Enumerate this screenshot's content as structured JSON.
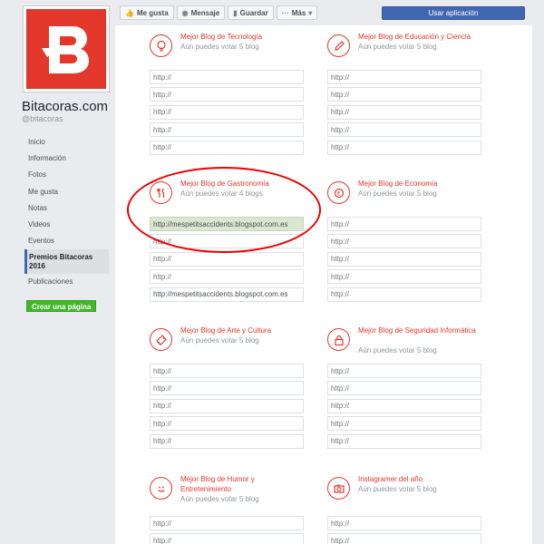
{
  "page": {
    "name": "Bitacoras.com",
    "handle": "@bitacoras",
    "logo_letter": "B",
    "brand_color": "#e4372b"
  },
  "nav": {
    "items": [
      {
        "label": "Inicio"
      },
      {
        "label": "Información"
      },
      {
        "label": "Fotos"
      },
      {
        "label": "Me gusta"
      },
      {
        "label": "Notas"
      },
      {
        "label": "Videos"
      },
      {
        "label": "Eventos"
      },
      {
        "label": "Premios Bitacoras 2016",
        "active": true
      },
      {
        "label": "Publicaciones"
      }
    ],
    "create_page_label": "Crear una página"
  },
  "toolbar": {
    "like_label": "Me gusta",
    "message_label": "Mensaje",
    "save_label": "Guardar",
    "more_label": "Más",
    "use_app_label": "Usar aplicación"
  },
  "categories": [
    {
      "title": "Mejor Blog de Tecnología",
      "votes": "Aún puedes votar 5 blog",
      "icon": "lightbulb-icon",
      "inputs": [
        {
          "value": "",
          "placeholder": "http://"
        },
        {
          "value": "",
          "placeholder": "http://"
        },
        {
          "value": "",
          "placeholder": "http://"
        },
        {
          "value": "",
          "placeholder": "http://"
        },
        {
          "value": "",
          "placeholder": "http://"
        }
      ]
    },
    {
      "title": "Mejor Blog de Educación y Ciencia",
      "votes": "Aún puedes votar 5 blog",
      "icon": "pencil-icon",
      "inputs": [
        {
          "value": "",
          "placeholder": "http://"
        },
        {
          "value": "",
          "placeholder": "http://"
        },
        {
          "value": "",
          "placeholder": "http://"
        },
        {
          "value": "",
          "placeholder": "http://"
        },
        {
          "value": "",
          "placeholder": "http://"
        }
      ]
    },
    {
      "title": "Mejor Blog de Gastronomía",
      "votes": "Aún puedes votar 4 blogs",
      "icon": "fork-knife-icon",
      "inputs": [
        {
          "value": "http://mespetitsaccidents.blogspot.com.es",
          "placeholder": "http://",
          "filled": true
        },
        {
          "value": "",
          "placeholder": "http://"
        },
        {
          "value": "",
          "placeholder": "http://"
        },
        {
          "value": "",
          "placeholder": "http://"
        },
        {
          "value": "http://mespetitsaccidents.blogspot.com.es",
          "placeholder": "http://"
        }
      ]
    },
    {
      "title": "Mejor Blog de Economía",
      "votes": "Aún puedes votar 5 blog",
      "icon": "euro-coin-icon",
      "inputs": [
        {
          "value": "",
          "placeholder": "http://"
        },
        {
          "value": "",
          "placeholder": "http://"
        },
        {
          "value": "",
          "placeholder": "http://"
        },
        {
          "value": "",
          "placeholder": "http://"
        },
        {
          "value": "",
          "placeholder": "http://"
        }
      ]
    },
    {
      "title": "Mejor Blog de Arte y Cultura",
      "votes": "Aún puedes votar 5 blog",
      "icon": "ticket-icon",
      "inputs": [
        {
          "value": "",
          "placeholder": "http://"
        },
        {
          "value": "",
          "placeholder": "http://"
        },
        {
          "value": "",
          "placeholder": "http://"
        },
        {
          "value": "",
          "placeholder": "http://"
        },
        {
          "value": "",
          "placeholder": "http://"
        }
      ]
    },
    {
      "title": "Mejor Blog de Seguridad Informática",
      "votes": "Aún puedes votar 5 blog",
      "icon": "lock-icon",
      "inputs": [
        {
          "value": "",
          "placeholder": "http://"
        },
        {
          "value": "",
          "placeholder": "http://"
        },
        {
          "value": "",
          "placeholder": "http://"
        },
        {
          "value": "",
          "placeholder": "http://"
        },
        {
          "value": "",
          "placeholder": "http://"
        }
      ]
    },
    {
      "title": "Mejor Blog de Humor y Entretenimiento",
      "votes": "Aún puedes votar 5 blog",
      "icon": "smiley-icon",
      "inputs": [
        {
          "value": "",
          "placeholder": "http://"
        },
        {
          "value": "",
          "placeholder": "http://"
        }
      ]
    },
    {
      "title": "Instagramer del año",
      "votes": "Aún puedes votar 5 blog",
      "icon": "camera-icon",
      "inputs": [
        {
          "value": "",
          "placeholder": "http://"
        },
        {
          "value": "",
          "placeholder": "http://"
        }
      ]
    }
  ]
}
